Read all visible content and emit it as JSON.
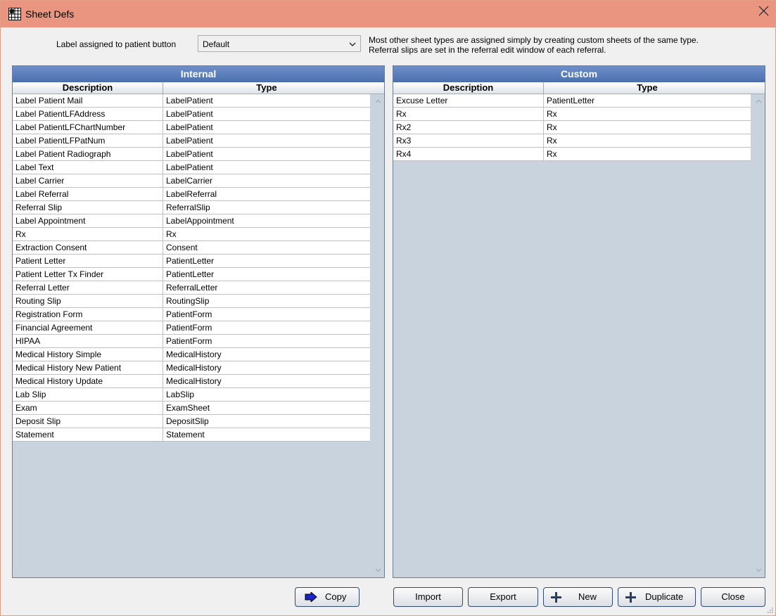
{
  "window": {
    "title": "Sheet Defs",
    "icon": "grid-icon",
    "close_icon": "close-icon"
  },
  "patient_button": {
    "label": "Label assigned to patient button",
    "value": "Default"
  },
  "note": {
    "line1": "Most other sheet types are assigned simply by creating custom sheets of the same type.",
    "line2": "Referral slips are set in the referral edit window of each referral."
  },
  "internal": {
    "title": "Internal",
    "columns": [
      "Description",
      "Type"
    ],
    "rows": [
      [
        "Label Patient Mail",
        "LabelPatient"
      ],
      [
        "Label PatientLFAddress",
        "LabelPatient"
      ],
      [
        "Label PatientLFChartNumber",
        "LabelPatient"
      ],
      [
        "Label PatientLFPatNum",
        "LabelPatient"
      ],
      [
        "Label Patient Radiograph",
        "LabelPatient"
      ],
      [
        "Label Text",
        "LabelPatient"
      ],
      [
        "Label Carrier",
        "LabelCarrier"
      ],
      [
        "Label Referral",
        "LabelReferral"
      ],
      [
        "Referral Slip",
        "ReferralSlip"
      ],
      [
        "Label Appointment",
        "LabelAppointment"
      ],
      [
        "Rx",
        "Rx"
      ],
      [
        "Extraction Consent",
        "Consent"
      ],
      [
        "Patient Letter",
        "PatientLetter"
      ],
      [
        "Patient Letter Tx Finder",
        "PatientLetter"
      ],
      [
        "Referral Letter",
        "ReferralLetter"
      ],
      [
        "Routing Slip",
        "RoutingSlip"
      ],
      [
        "Registration Form",
        "PatientForm"
      ],
      [
        "Financial Agreement",
        "PatientForm"
      ],
      [
        "HIPAA",
        "PatientForm"
      ],
      [
        "Medical History Simple",
        "MedicalHistory"
      ],
      [
        "Medical History New Patient",
        "MedicalHistory"
      ],
      [
        "Medical History Update",
        "MedicalHistory"
      ],
      [
        "Lab Slip",
        "LabSlip"
      ],
      [
        "Exam",
        "ExamSheet"
      ],
      [
        "Deposit Slip",
        "DepositSlip"
      ],
      [
        "Statement",
        "Statement"
      ]
    ]
  },
  "custom": {
    "title": "Custom",
    "columns": [
      "Description",
      "Type"
    ],
    "rows": [
      [
        "Excuse Letter",
        "PatientLetter"
      ],
      [
        "Rx",
        "Rx"
      ],
      [
        "Rx2",
        "Rx"
      ],
      [
        "Rx3",
        "Rx"
      ],
      [
        "Rx4",
        "Rx"
      ]
    ]
  },
  "buttons": {
    "copy": "Copy",
    "import": "Import",
    "export": "Export",
    "new": "New",
    "duplicate": "Duplicate",
    "close": "Close"
  },
  "colors": {
    "titlebar": "#ea9580",
    "grid_header": "#5a7dbb",
    "grid_background": "#c8d3de"
  }
}
